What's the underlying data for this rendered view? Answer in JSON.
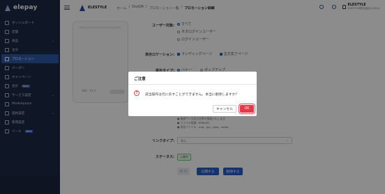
{
  "sidebar": {
    "logo": "elepay",
    "items": [
      {
        "label": "ダッシュボード",
        "icon": "dashboard-icon"
      },
      {
        "label": "店舗",
        "icon": "store-icon"
      },
      {
        "label": "商品",
        "icon": "product-icon",
        "expandable": true
      },
      {
        "label": "注文",
        "icon": "order-icon"
      },
      {
        "label": "プロモーション",
        "icon": "promotion-icon",
        "active": true
      },
      {
        "label": "クーポン",
        "icon": "coupon-icon"
      },
      {
        "label": "キャンペーン",
        "icon": "campaign-icon"
      },
      {
        "label": "会計",
        "icon": "accounting-icon",
        "badge": "NEW"
      },
      {
        "label": "サービス設定",
        "icon": "service-settings-icon",
        "expandable": true
      },
      {
        "label": "Marketplace",
        "icon": "marketplace-icon"
      },
      {
        "label": "契約設定",
        "icon": "contract-icon",
        "expandable": true
      },
      {
        "label": "質問設定",
        "icon": "question-icon"
      },
      {
        "label": "ツール",
        "icon": "tool-icon",
        "badge": "NEW"
      }
    ]
  },
  "header": {
    "brand": "ELESTYLE",
    "breadcrumb": [
      "ホーム",
      "OneQR",
      "プロモーション一覧",
      "プロモーション詳細"
    ],
    "user_name": "ELESTYLE",
    "user_org": "ELESTYLE株式会社(ｴﾚｽﾀｲﾙ)"
  },
  "form": {
    "user_target_label": "ユーザー対象:",
    "user_target_options": [
      "すべて",
      "ネオログインユーザー",
      "ログインユーザー"
    ],
    "display_location_label": "表示ロケーション:",
    "display_location_options": [
      "ランディングページ",
      "注文完了ページ"
    ],
    "display_type_label": "表示タイプ:",
    "display_type_options": [
      "バナー",
      "ポップアップ"
    ],
    "preview_price": "¥88 · ¥1.0",
    "image_notes": [
      "● 推奨サイズ及び比率を推奨いたします",
      "● ファイル容量: 5MB以内",
      "● 対応ファイル: .png, .jpg, .jpeg, .webp"
    ],
    "link_type_label": "リンクタイプ:",
    "link_type_value": "なし",
    "status_label": "ステータス:",
    "status_value": "公開中"
  },
  "actions": {
    "save": "保 存",
    "publish": "公開する",
    "delete": "削除する"
  },
  "dialog": {
    "title": "ご注意",
    "message": "該当操作は元に戻すことができません。本当に削除しますか？",
    "cancel": "キャンセル",
    "ok": "OK",
    "ok_color": "#e53945"
  }
}
